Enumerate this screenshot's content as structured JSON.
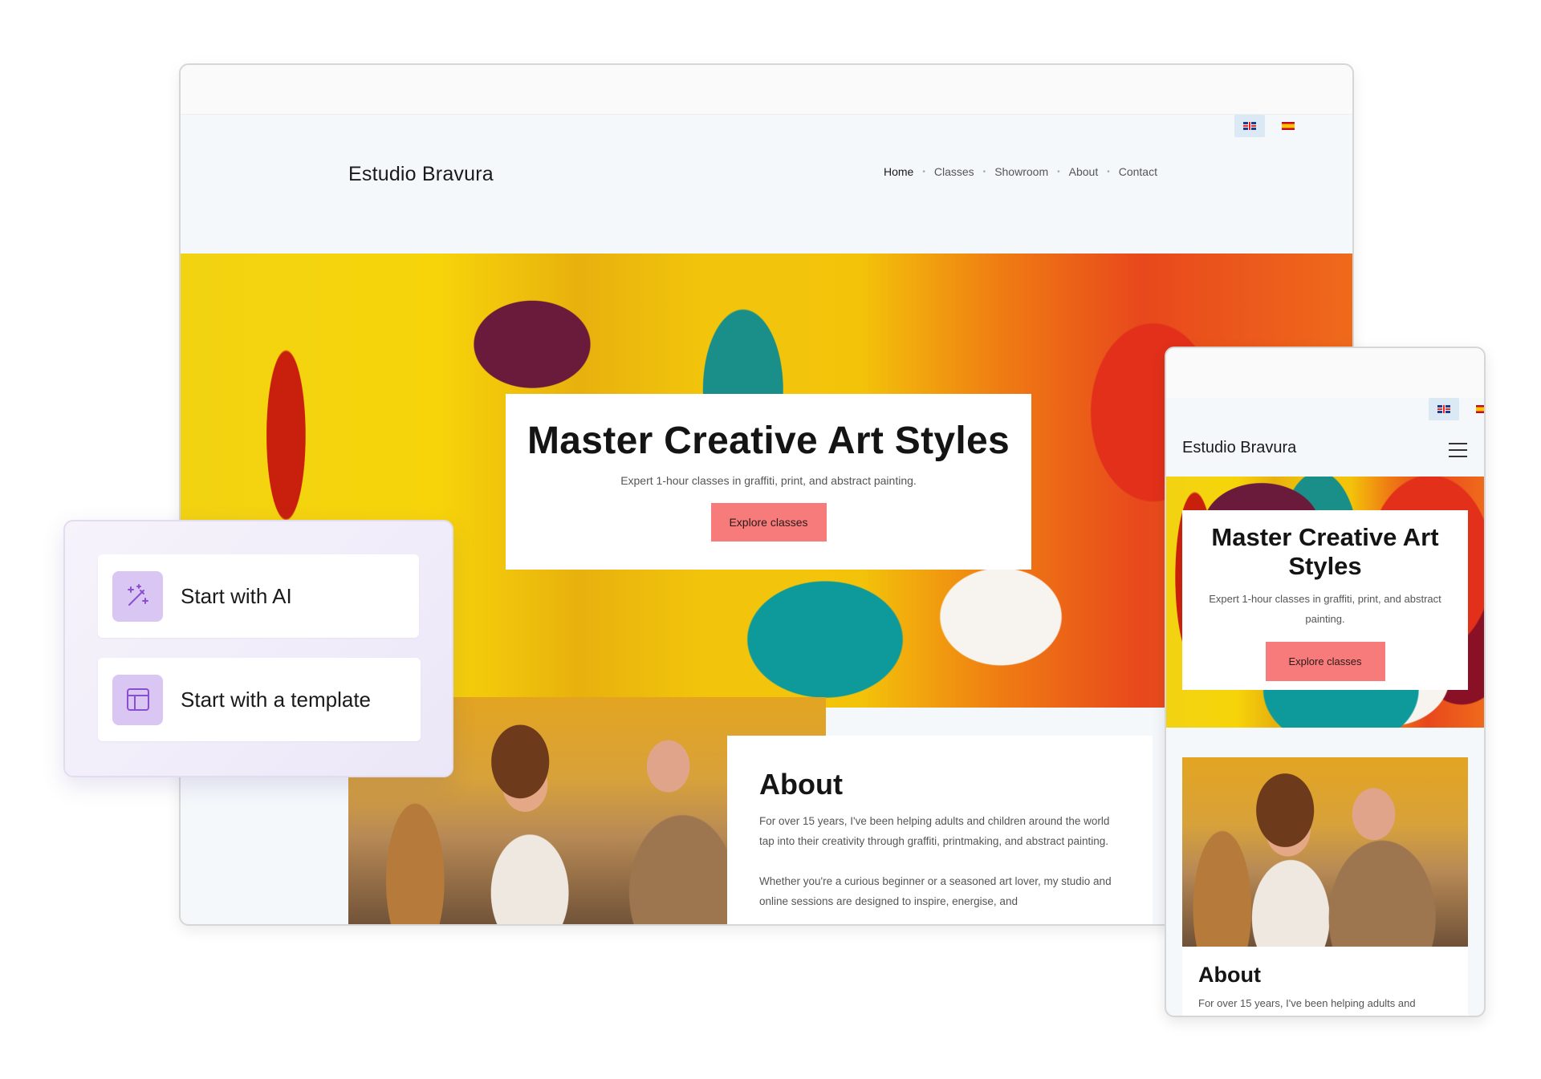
{
  "brand": "Estudio Bravura",
  "languages": [
    {
      "code": "en",
      "icon": "uk-flag-icon",
      "active": true
    },
    {
      "code": "es",
      "icon": "spain-flag-icon",
      "active": false
    }
  ],
  "nav": [
    "Home",
    "Classes",
    "Showroom",
    "About",
    "Contact"
  ],
  "hero": {
    "title": "Master Creative Art Styles",
    "subtitle": "Expert 1-hour classes in graffiti, print, and abstract painting.",
    "button": "Explore classes"
  },
  "about": {
    "title": "About",
    "paragraph1": "For over 15 years, I've been helping adults and children around the world tap into their creativity through graffiti, printmaking, and abstract painting.",
    "paragraph2": "Whether you're a curious beginner or a seasoned art lover, my studio and online sessions are designed to inspire, energise, and",
    "mobile_excerpt": "For over 15 years, I've been helping adults and"
  },
  "start": {
    "ai_label": "Start with AI",
    "ai_icon": "magic-wand-icon",
    "template_label": "Start with a template",
    "template_icon": "layout-template-icon"
  },
  "colors": {
    "accent_button": "#f77b7b",
    "page_bg": "#f4f8fb",
    "icon_tile": "#d9c6f2"
  }
}
